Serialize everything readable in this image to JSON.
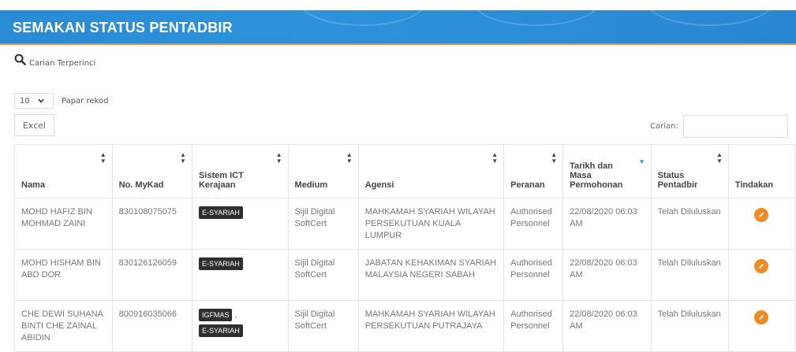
{
  "header": {
    "title": "SEMAKAN STATUS PENTADBIR"
  },
  "advanced_search": {
    "label": "Carian Terperinci",
    "icon": "search-icon"
  },
  "length_menu": {
    "value": "10",
    "label": "Papar rekod"
  },
  "toolbar": {
    "excel_label": "Excel"
  },
  "search": {
    "label": "Carian:",
    "value": ""
  },
  "table": {
    "headers": [
      "Nama",
      "No. MyKad",
      "Sistem ICT Kerajaan",
      "Medium",
      "Agensi",
      "Peranan",
      "Tarikh dan Masa Permohonan",
      "Status Pentadbir",
      "Tindakan"
    ],
    "rows": [
      {
        "nama": "MOHD HAFIZ BIN MOHMAD ZAINI",
        "mykad": "830108075075",
        "sistem": [
          "E-SYARIAH"
        ],
        "medium": "Sijil Digital SoftCert",
        "agensi": "MAHKAMAH SYARIAH WILAYAH PERSEKUTUAN KUALA LUMPUR",
        "peranan": "Authorised Personnel",
        "tarikh": "22/08/2020 06:03 AM",
        "status": "Telah Diluluskan"
      },
      {
        "nama": "MOHD HISHAM BIN ABD DOR",
        "mykad": "830126126059",
        "sistem": [
          "E-SYARIAH"
        ],
        "medium": "Sijil Digital SoftCert",
        "agensi": "JABATAN KEHAKIMAN SYARIAH MALAYSIA NEGERI SABAH",
        "peranan": "Authorised Personnel",
        "tarikh": "22/08/2020 06:03 AM",
        "status": "Telah Diluluskan"
      },
      {
        "nama": "CHE DEWI SUHANA BINTI CHE ZAINAL ABIDIN",
        "mykad": "800916035066",
        "sistem": [
          "IGFMAS",
          "E-SYARIAH"
        ],
        "medium": "Sijil Digital SoftCert",
        "agensi": "MAHKAMAH SYARIAH WILAYAH PERSEKUTUAN PUTRAJAYA",
        "peranan": "Authorised Personnel",
        "tarikh": "22/08/2020 06:03 AM",
        "status": "Telah Diluluskan"
      }
    ]
  },
  "colors": {
    "header_bg": "#2a8bd6",
    "header_border": "#f08a3a",
    "action": "#f08a24",
    "badge": "#2f2f2f"
  }
}
